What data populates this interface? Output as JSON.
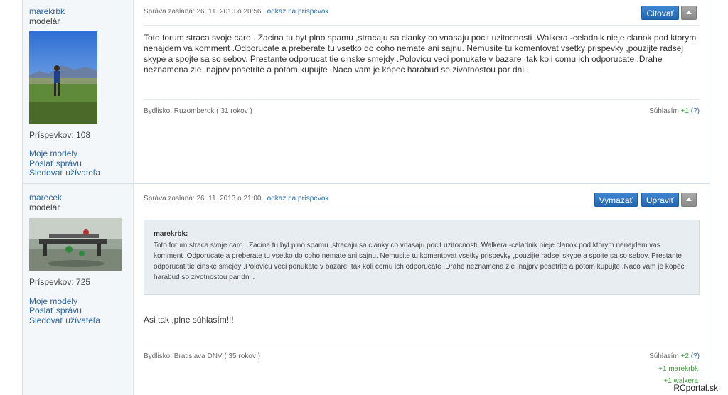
{
  "posts": [
    {
      "username": "marekrbk",
      "usertitle": "modelár",
      "postcount": "Príspevkov: 108",
      "user_links": [
        "Moje modely",
        "Poslať správu",
        "Sledovať užívateľa"
      ],
      "meta_prefix": "Správa zaslaná: 26. 11. 2013 o 20:56 |",
      "meta_link": "odkaz na príspevok",
      "buttons": [
        "Citovať"
      ],
      "text": "Toto forum straca svoje caro . Zacina tu byt plno spamu ,stracaju sa clanky co vnasaju pocit uzitocnosti .Walkera -celadnik nieje clanok pod ktorym nenajdem va komment .Odporucate a preberate tu vsetko do coho nemate ani sajnu. Nemusite tu komentovat vsetky prispevky ,pouzijte radsej skype a spojte sa so sebov. Prestante odporucat tie cinske smejdy .Polovicu veci ponukate v bazare ,tak koli comu ich odporucate .Drahe neznamena zle ,najprv posetrite a potom kupujte .Naco vam je kopec harabud so zivotnostou par dni .",
      "residence": "Bydlisko: Ruzomberok ( 31 rokov )",
      "agree_label": "Súhlasím",
      "agree_count": "+1",
      "agree_help": "(?)"
    },
    {
      "username": "marecek",
      "usertitle": "modelár",
      "postcount": "Príspevkov: 725",
      "user_links": [
        "Moje modely",
        "Poslať správu",
        "Sledovať užívateľa"
      ],
      "meta_prefix": "Správa zaslaná: 26. 11. 2013 o 21:00 |",
      "meta_link": "odkaz na príspevok",
      "buttons": [
        "Vymazať",
        "Upraviť"
      ],
      "quote_author": "marekrbk:",
      "quote_text": "Toto forum straca svoje caro . Zacina tu byt plno spamu ,stracaju sa clanky co vnasaju pocit uzitocnosti .Walkera -celadnik nieje clanok pod ktorym nenajdem vas komment .Odporucate a preberate tu vsetko do coho nemate ani sajnu. Nemusite tu komentovat vsetky prispevky ,pouzijte radsej skype a spojte sa so sebov. Prestante odporucat tie cinske smejdy .Polovicu veci ponukate v bazare ,tak koli comu ich odporucate .Drahe neznamena zle ,najprv posetrite a potom kupujte .Naco vam je kopec harabud so zivotnostou par dni .",
      "text": "Asi tak ,plne súhlasím!!!",
      "residence": "Bydlisko: Bratislava DNV ( 35 rokov )",
      "agree_label": "Súhlasím",
      "agree_count": "+2",
      "agree_help": "(?)",
      "agree_users": [
        "+1 marekrbk",
        "+1 walkera"
      ]
    }
  ],
  "watermark": "RCportal.sk"
}
